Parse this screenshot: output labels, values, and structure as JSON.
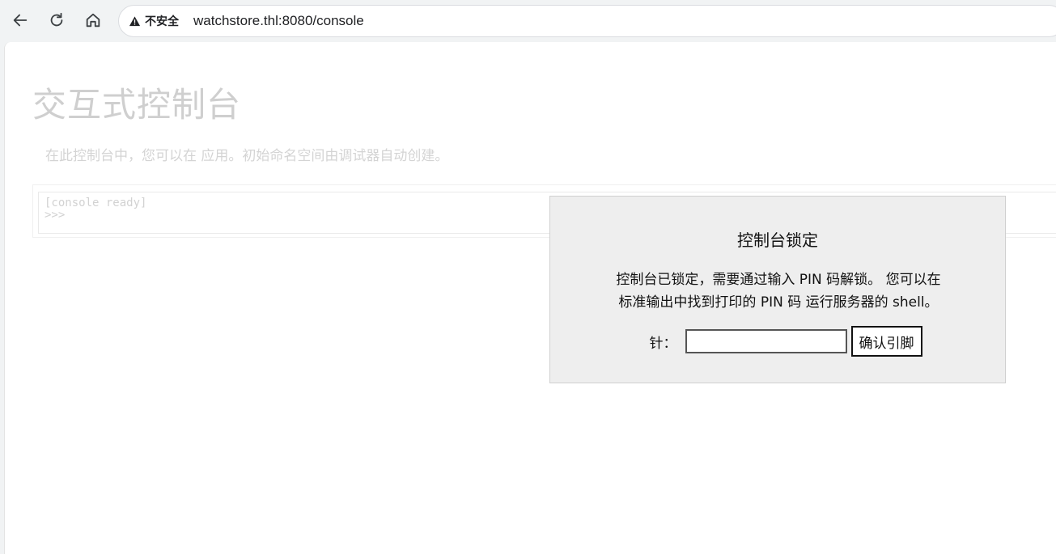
{
  "browser": {
    "security_label": "不安全",
    "url": "watchstore.thl:8080/console",
    "icons": [
      "back-icon",
      "reload-icon",
      "home-icon",
      "warning-icon"
    ]
  },
  "page": {
    "title": "交互式控制台",
    "intro": "在此控制台中，您可以在 应用。初始命名空间由调试器自动创建。",
    "console": {
      "line1": "[console ready]",
      "prompt": ">>>"
    }
  },
  "dialog": {
    "title": "控制台锁定",
    "message_line1": "控制台已锁定，需要通过输入 PIN 码解锁。 您可以在",
    "message_line2": "标准输出中找到打印的 PIN 码 运行服务器的 shell。",
    "pin_label": "针：",
    "pin_value": "",
    "confirm_button": "确认引脚"
  }
}
